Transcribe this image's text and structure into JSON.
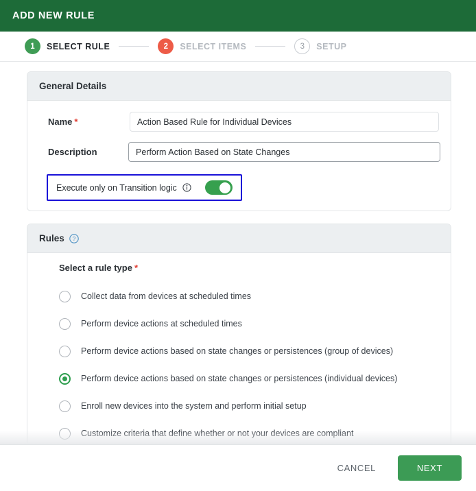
{
  "header": {
    "title": "ADD NEW RULE",
    "bg_color": "#1d6b38"
  },
  "stepper": {
    "steps": [
      {
        "number": "1",
        "label": "SELECT RULE",
        "state": "done",
        "color": "#3f9c55"
      },
      {
        "number": "2",
        "label": "SELECT ITEMS",
        "state": "alert",
        "color": "#ed5b47"
      },
      {
        "number": "3",
        "label": "SETUP",
        "state": "upcoming",
        "color": "#c9cdd2"
      }
    ]
  },
  "general_details": {
    "panel_title": "General Details",
    "name_label": "Name",
    "name_required": "*",
    "name_value": "Action Based Rule for Individual Devices",
    "name_placeholder": "",
    "description_label": "Description",
    "description_value": "Perform Action Based on State Changes",
    "description_placeholder": "",
    "transition_toggle_label": "Execute only on Transition logic",
    "transition_toggle_state": "on",
    "focus_outline_color": "#1a11d8",
    "toggle_on_color": "#36a04e"
  },
  "rules": {
    "panel_title": "Rules",
    "help_icon": "question-circle-icon",
    "subtitle": "Select a rule type",
    "subtitle_required": "*",
    "selected_index": 3,
    "options": [
      "Collect data from devices at scheduled times",
      "Perform device actions at scheduled times",
      "Perform device actions based on state changes or persistences (group of devices)",
      "Perform device actions based on state changes or persistences (individual devices)",
      "Enroll new devices into the system and perform initial setup",
      "Customize criteria that define whether or not your devices are compliant"
    ],
    "selected_color": "#2e9e4f"
  },
  "footer": {
    "cancel_label": "CANCEL",
    "next_label": "NEXT",
    "next_color": "#3c9b55"
  }
}
